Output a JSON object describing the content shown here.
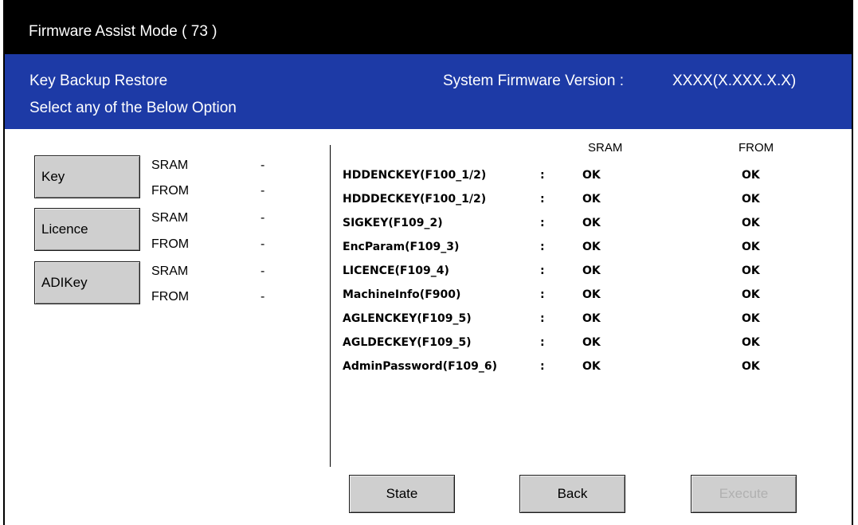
{
  "titlebar": {
    "title": "Firmware Assist Mode ( 73 )"
  },
  "info": {
    "line1": "Key Backup Restore",
    "line2": "Select any of the Below Option",
    "version_label": "System Firmware Version :",
    "version_value": "XXXX(X.XXX.X.X)"
  },
  "left_options": [
    {
      "button": "Key",
      "rows": [
        {
          "label": "SRAM",
          "value": "-"
        },
        {
          "label": "FROM",
          "value": "-"
        }
      ]
    },
    {
      "button": "Licence",
      "rows": [
        {
          "label": "SRAM",
          "value": "-"
        },
        {
          "label": "FROM",
          "value": "-"
        }
      ]
    },
    {
      "button": "ADIKey",
      "rows": [
        {
          "label": "SRAM",
          "value": "-"
        },
        {
          "label": "FROM",
          "value": "-"
        }
      ]
    }
  ],
  "status_table": {
    "headers": {
      "sram": "SRAM",
      "from": "FROM"
    },
    "rows": [
      {
        "name": "HDDENCKEY(F100_1/2)",
        "colon": ":",
        "sram": "OK",
        "from": "OK"
      },
      {
        "name": "HDDDECKEY(F100_1/2)",
        "colon": ":",
        "sram": "OK",
        "from": "OK"
      },
      {
        "name": "SIGKEY(F109_2)",
        "colon": ":",
        "sram": "OK",
        "from": "OK"
      },
      {
        "name": "EncParam(F109_3)",
        "colon": ":",
        "sram": "OK",
        "from": "OK"
      },
      {
        "name": "LICENCE(F109_4)",
        "colon": ":",
        "sram": "OK",
        "from": "OK"
      },
      {
        "name": "MachineInfo(F900)",
        "colon": ":",
        "sram": "OK",
        "from": "OK"
      },
      {
        "name": "AGLENCKEY(F109_5)",
        "colon": ":",
        "sram": "OK",
        "from": "OK"
      },
      {
        "name": "AGLDECKEY(F109_5)",
        "colon": ":",
        "sram": "OK",
        "from": "OK"
      },
      {
        "name": "AdminPassword(F109_6)",
        "colon": ":",
        "sram": "OK",
        "from": "OK"
      }
    ]
  },
  "buttons": {
    "state": "State",
    "back": "Back",
    "execute": "Execute"
  },
  "colors": {
    "title_bg": "#000000",
    "info_bg": "#1d3aa6",
    "button_bg": "#cfcfcf",
    "disabled_text": "#b0b0b0"
  }
}
